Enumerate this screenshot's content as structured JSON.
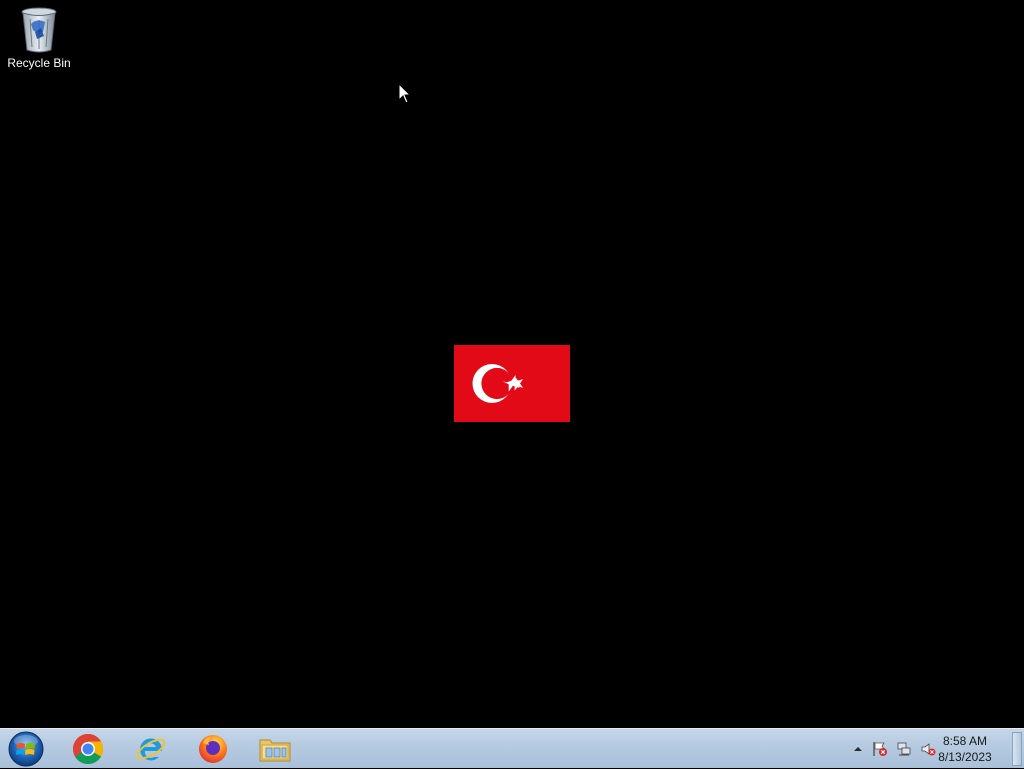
{
  "desktop": {
    "icons": [
      {
        "label": "Recycle Bin",
        "icon": "recycle-bin-icon"
      }
    ],
    "wallpaper": {
      "icon": "turkish-flag",
      "colors": {
        "red": "#e30a17",
        "white": "#ffffff"
      }
    }
  },
  "taskbar": {
    "start": {
      "icon": "windows-start-orb"
    },
    "pinned": [
      {
        "name": "Google Chrome",
        "icon": "chrome-icon"
      },
      {
        "name": "Internet Explorer",
        "icon": "internet-explorer-icon"
      },
      {
        "name": "Firefox",
        "icon": "firefox-icon"
      },
      {
        "name": "Windows Explorer",
        "icon": "file-explorer-icon"
      }
    ],
    "tray": {
      "icons": [
        "show-hidden-icons-arrow",
        "action-center-flag-icon",
        "network-icon",
        "volume-muted-icon"
      ],
      "clock": {
        "time": "8:58 AM",
        "date": "8/13/2023"
      }
    }
  }
}
